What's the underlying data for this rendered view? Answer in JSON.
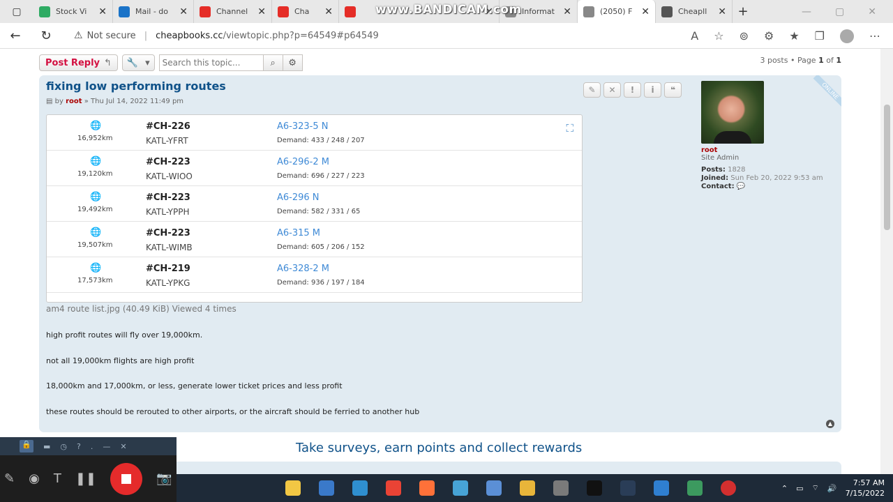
{
  "tabs": [
    {
      "label": "Stock Vi",
      "color": "#2eab63"
    },
    {
      "label": "Mail - do",
      "color": "#1a73c8"
    },
    {
      "label": "Channel",
      "color": "#e52d27"
    },
    {
      "label": "Cha",
      "color": "#e52d27"
    },
    {
      "label": "",
      "color": "#e52d27"
    },
    {
      "label": "Informat",
      "color": "#888888"
    },
    {
      "label": "(2050) F",
      "color": "#888888"
    },
    {
      "label": "Cheapll",
      "color": "#555555"
    }
  ],
  "watermark": "www.BANDICAM.com",
  "address": {
    "security": "Not secure",
    "domain": "cheapbooks.cc",
    "path": "/viewtopic.php?p=64549#p64549"
  },
  "toolbar": {
    "post_reply": "Post Reply",
    "search_placeholder": "Search this topic..."
  },
  "pagination": {
    "posts": "3 posts",
    "page_label": "Page",
    "current": "1",
    "of": "of",
    "total": "1"
  },
  "post": {
    "title": "fixing low performing routes",
    "by": "by",
    "author": "root",
    "date": "» Thu Jul 14, 2022 11:49 pm",
    "attachment": "am4 route list.jpg (40.49 KiB) Viewed 4 times",
    "paragraphs": [
      "high profit routes will fly over 19,000km.",
      "not all 19,000km flights are high profit",
      "18,000km and 17,000km, or less, generate lower ticket prices and less profit",
      "these routes should be rerouted to other airports, or the aircraft should be ferried to another hub"
    ],
    "online": "ONLINE"
  },
  "routes": [
    {
      "dist": "16,952km",
      "code": "#CH-226",
      "path": "KATL-YFRT",
      "aircraft": "A6-323-5 N",
      "demand": "Demand: 433 / 248 / 207"
    },
    {
      "dist": "19,120km",
      "code": "#CH-223",
      "path": "KATL-WIOO",
      "aircraft": "A6-296-2 M",
      "demand": "Demand: 696 / 227 / 223"
    },
    {
      "dist": "19,492km",
      "code": "#CH-223",
      "path": "KATL-YPPH",
      "aircraft": "A6-296 N",
      "demand": "Demand: 582 / 331 / 65"
    },
    {
      "dist": "19,507km",
      "code": "#CH-223",
      "path": "KATL-WIMB",
      "aircraft": "A6-315 M",
      "demand": "Demand: 605 / 206 / 152"
    },
    {
      "dist": "17,573km",
      "code": "#CH-219",
      "path": "KATL-YPKG",
      "aircraft": "A6-328-2 M",
      "demand": "Demand: 936 / 197 / 184"
    }
  ],
  "profile": {
    "name": "root",
    "rank": "Site Admin",
    "posts_label": "Posts:",
    "posts": "1828",
    "joined_label": "Joined:",
    "joined": "Sun Feb 20, 2022 9:53 am",
    "contact_label": "Contact:"
  },
  "ad": "Take surveys, earn points and collect rewards",
  "clock": {
    "time": "7:57 AM",
    "date": "7/15/2022"
  }
}
